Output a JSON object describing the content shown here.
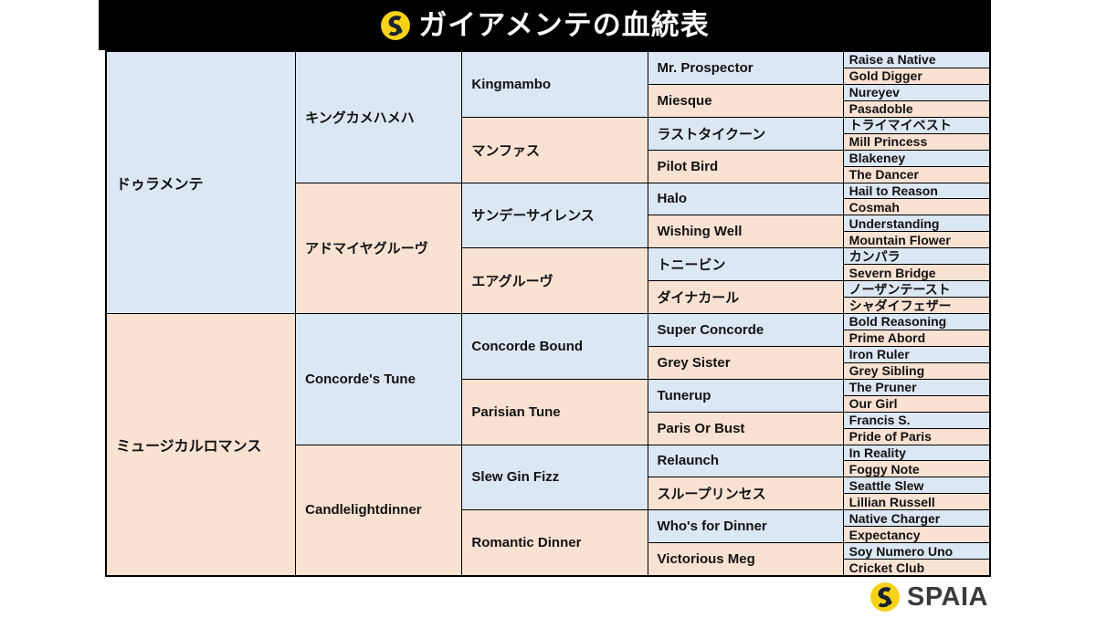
{
  "header": {
    "title": "ガイアメンテの血統表",
    "logo_icon": "spaia-swirl-icon",
    "background_color": "#000000",
    "text_color": "#ffffff"
  },
  "colors": {
    "sire": "#dbe7f3",
    "dam": "#fae2d3",
    "border": "#000000",
    "brand_yellow": "#f5d217",
    "brand_dark": "#3b3b3b"
  },
  "footer": {
    "brand": "SPAIA",
    "logo_icon": "spaia-swirl-icon"
  },
  "pedigree": {
    "generation1": [
      {
        "name": "ドゥラメンテ",
        "type": "sire"
      },
      {
        "name": "ミュージカルロマンス",
        "type": "dam"
      }
    ],
    "generation2": [
      {
        "name": "キングカメハメハ",
        "type": "sire"
      },
      {
        "name": "アドマイヤグルーヴ",
        "type": "dam"
      },
      {
        "name": "Concorde's Tune",
        "type": "sire"
      },
      {
        "name": "Candlelightdinner",
        "type": "dam"
      }
    ],
    "generation3": [
      {
        "name": "Kingmambo",
        "type": "sire"
      },
      {
        "name": "マンファス",
        "type": "dam"
      },
      {
        "name": "サンデーサイレンス",
        "type": "sire"
      },
      {
        "name": "エアグルーヴ",
        "type": "dam"
      },
      {
        "name": "Concorde Bound",
        "type": "sire"
      },
      {
        "name": "Parisian Tune",
        "type": "dam"
      },
      {
        "name": "Slew Gin Fizz",
        "type": "sire"
      },
      {
        "name": "Romantic Dinner",
        "type": "dam"
      }
    ],
    "generation4": [
      {
        "name": "Mr. Prospector",
        "type": "sire"
      },
      {
        "name": "Miesque",
        "type": "dam"
      },
      {
        "name": "ラストタイクーン",
        "type": "sire"
      },
      {
        "name": "Pilot Bird",
        "type": "dam"
      },
      {
        "name": "Halo",
        "type": "sire"
      },
      {
        "name": "Wishing Well",
        "type": "dam"
      },
      {
        "name": "トニービン",
        "type": "sire"
      },
      {
        "name": "ダイナカール",
        "type": "dam"
      },
      {
        "name": "Super Concorde",
        "type": "sire"
      },
      {
        "name": "Grey Sister",
        "type": "dam"
      },
      {
        "name": "Tunerup",
        "type": "sire"
      },
      {
        "name": "Paris Or Bust",
        "type": "dam"
      },
      {
        "name": "Relaunch",
        "type": "sire"
      },
      {
        "name": "スループリンセス",
        "type": "dam"
      },
      {
        "name": "Who's for Dinner",
        "type": "sire"
      },
      {
        "name": "Victorious Meg",
        "type": "dam"
      }
    ],
    "generation5": [
      {
        "name": "Raise a Native",
        "type": "sire"
      },
      {
        "name": "Gold Digger",
        "type": "dam"
      },
      {
        "name": "Nureyev",
        "type": "sire"
      },
      {
        "name": "Pasadoble",
        "type": "dam"
      },
      {
        "name": "トライマイベスト",
        "type": "sire"
      },
      {
        "name": "Mill Princess",
        "type": "dam"
      },
      {
        "name": "Blakeney",
        "type": "sire"
      },
      {
        "name": "The Dancer",
        "type": "dam"
      },
      {
        "name": "Hail to Reason",
        "type": "sire"
      },
      {
        "name": "Cosmah",
        "type": "dam"
      },
      {
        "name": "Understanding",
        "type": "sire"
      },
      {
        "name": "Mountain Flower",
        "type": "dam"
      },
      {
        "name": "カンパラ",
        "type": "sire"
      },
      {
        "name": "Severn Bridge",
        "type": "dam"
      },
      {
        "name": "ノーザンテースト",
        "type": "sire"
      },
      {
        "name": "シャダイフェザー",
        "type": "dam"
      },
      {
        "name": "Bold Reasoning",
        "type": "sire"
      },
      {
        "name": "Prime Abord",
        "type": "dam"
      },
      {
        "name": "Iron Ruler",
        "type": "sire"
      },
      {
        "name": "Grey Sibling",
        "type": "dam"
      },
      {
        "name": "The Pruner",
        "type": "sire"
      },
      {
        "name": "Our Girl",
        "type": "dam"
      },
      {
        "name": "Francis S.",
        "type": "sire"
      },
      {
        "name": "Pride of Paris",
        "type": "dam"
      },
      {
        "name": "In Reality",
        "type": "sire"
      },
      {
        "name": "Foggy Note",
        "type": "dam"
      },
      {
        "name": "Seattle Slew",
        "type": "sire"
      },
      {
        "name": "Lillian Russell",
        "type": "dam"
      },
      {
        "name": "Native Charger",
        "type": "sire"
      },
      {
        "name": "Expectancy",
        "type": "dam"
      },
      {
        "name": "Soy Numero Uno",
        "type": "sire"
      },
      {
        "name": "Cricket Club",
        "type": "dam"
      }
    ]
  }
}
